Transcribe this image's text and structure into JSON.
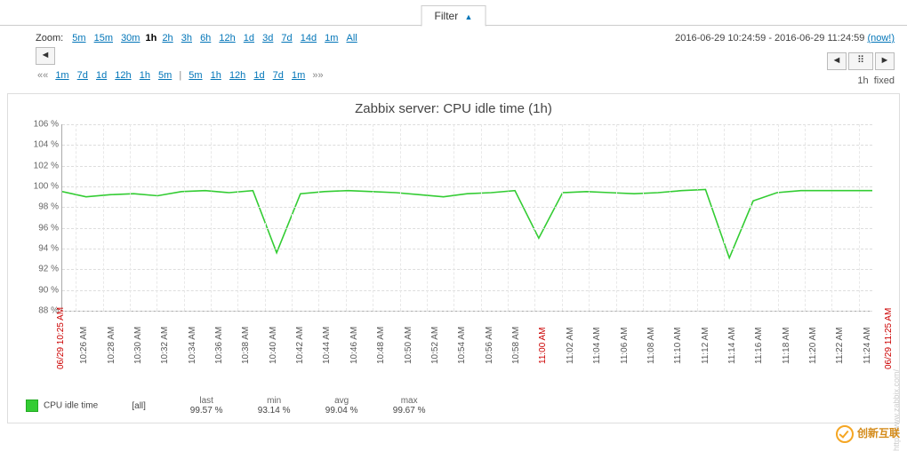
{
  "filter": {
    "label": "Filter"
  },
  "zoom": {
    "label": "Zoom:",
    "options": [
      "5m",
      "15m",
      "30m",
      "1h",
      "2h",
      "3h",
      "6h",
      "12h",
      "1d",
      "3d",
      "7d",
      "14d",
      "1m",
      "All"
    ],
    "selected": "1h"
  },
  "timerange": {
    "from": "2016-06-29 10:24:59",
    "sep": " - ",
    "to": "2016-06-29 11:24:59",
    "now": "(now!)"
  },
  "steps": {
    "left_sym": "««",
    "right_sym": "»»",
    "left": [
      "1m",
      "7d",
      "1d",
      "12h",
      "1h",
      "5m"
    ],
    "right": [
      "5m",
      "1h",
      "12h",
      "1d",
      "7d",
      "1m"
    ]
  },
  "period_info": {
    "len": "1h",
    "mode": "fixed"
  },
  "legend": {
    "series": "CPU idle time",
    "scope": "[all]",
    "cols": [
      "last",
      "min",
      "avg",
      "max"
    ],
    "vals": [
      "99.57 %",
      "93.14 %",
      "99.04 %",
      "99.67 %"
    ]
  },
  "watermark": "http://www.zabbix.com/",
  "brand": "创新互联",
  "chart_data": {
    "type": "line",
    "title": "Zabbix server: CPU idle time (1h)",
    "ylabel": "%",
    "ylim": [
      88,
      106
    ],
    "yticks": [
      88,
      90,
      92,
      94,
      96,
      98,
      100,
      102,
      104,
      106
    ],
    "x_labels": [
      "10:26 AM",
      "10:28 AM",
      "10:30 AM",
      "10:32 AM",
      "10:34 AM",
      "10:36 AM",
      "10:38 AM",
      "10:40 AM",
      "10:42 AM",
      "10:44 AM",
      "10:46 AM",
      "10:48 AM",
      "10:50 AM",
      "10:52 AM",
      "10:54 AM",
      "10:56 AM",
      "10:58 AM",
      "11:00 AM",
      "11:02 AM",
      "11:04 AM",
      "11:06 AM",
      "11:08 AM",
      "11:10 AM",
      "11:12 AM",
      "11:14 AM",
      "11:16 AM",
      "11:18 AM",
      "11:20 AM",
      "11:22 AM",
      "11:24 AM"
    ],
    "x_red_markers": [
      "06/29 10:25 AM",
      "11:00 AM",
      "06/29 11:25 AM"
    ],
    "series": [
      {
        "name": "CPU idle time",
        "color": "#33cc33",
        "values": [
          99.5,
          99.0,
          99.2,
          99.3,
          99.1,
          99.5,
          99.6,
          99.4,
          99.6,
          93.6,
          99.3,
          99.5,
          99.6,
          99.5,
          99.4,
          99.2,
          99.0,
          99.3,
          99.4,
          99.6,
          95.0,
          99.4,
          99.5,
          99.4,
          99.3,
          99.4,
          99.6,
          99.7,
          93.1,
          98.6,
          99.4,
          99.6,
          99.6,
          99.6,
          99.6
        ]
      }
    ]
  }
}
